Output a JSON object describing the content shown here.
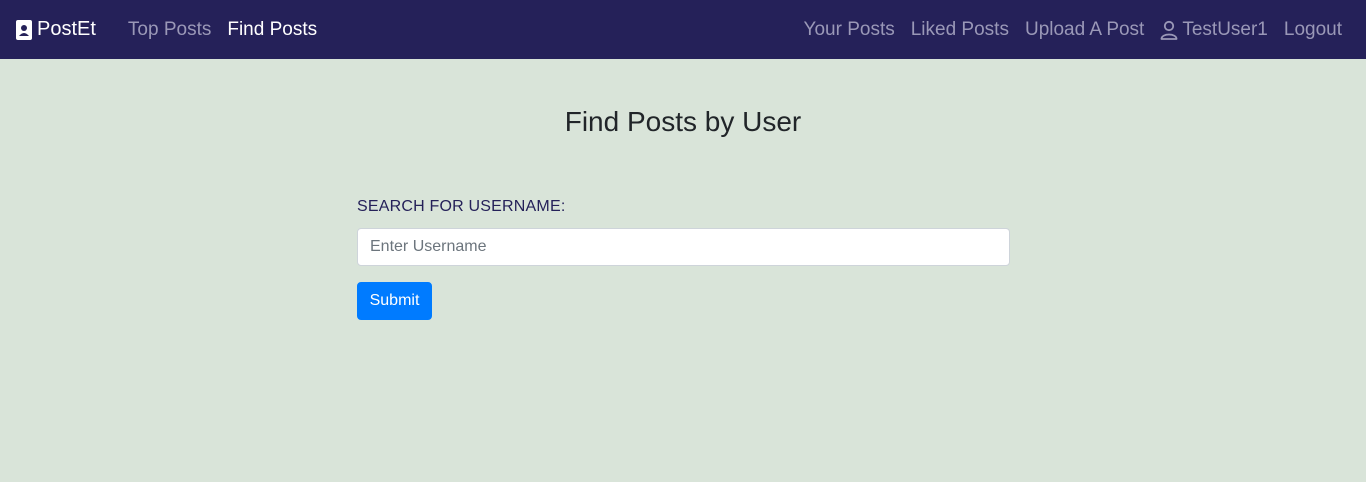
{
  "navbar": {
    "brand": {
      "label": "PostEt",
      "icon": "person-badge-icon"
    },
    "left_links": [
      {
        "label": "Top Posts",
        "active": false
      },
      {
        "label": "Find Posts",
        "active": true
      }
    ],
    "right_links": [
      {
        "label": "Your Posts"
      },
      {
        "label": "Liked Posts"
      },
      {
        "label": "Upload A Post"
      },
      {
        "label": "TestUser1",
        "icon": "user-icon"
      },
      {
        "label": "Logout"
      }
    ],
    "colors": {
      "background": "#252159",
      "inactive_link": "#9a98b7",
      "active_link": "#ffffff"
    }
  },
  "main": {
    "title": "Find Posts by User",
    "search": {
      "label": "SEARCH FOR USERNAME:",
      "value": "",
      "placeholder": "Enter Username",
      "submit_label": "Submit"
    },
    "colors": {
      "background": "#d9e4d9",
      "primary_button": "#007bff"
    }
  }
}
